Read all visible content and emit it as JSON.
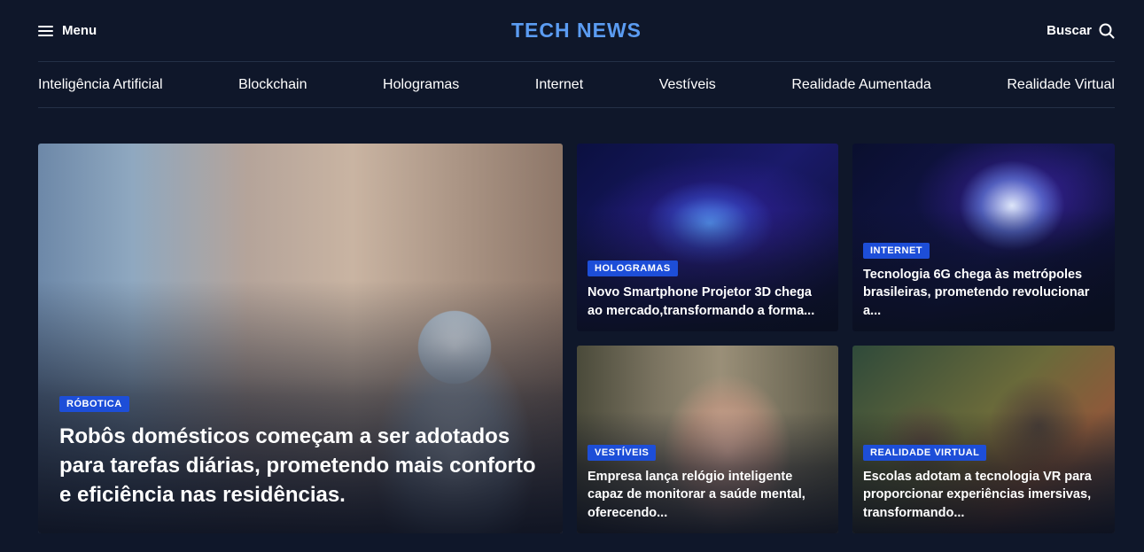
{
  "header": {
    "menu_label": "Menu",
    "logo": "TECH NEWS",
    "search_label": "Buscar"
  },
  "nav": {
    "items": [
      {
        "label": "Inteligência Artificial"
      },
      {
        "label": "Blockchain"
      },
      {
        "label": "Hologramas"
      },
      {
        "label": "Internet"
      },
      {
        "label": "Vestíveis"
      },
      {
        "label": "Realidade Aumentada"
      },
      {
        "label": "Realidade Virtual"
      }
    ]
  },
  "colors": {
    "background": "#0f172a",
    "logo": "#5b9cf2",
    "badge": "#1d4ed8"
  },
  "featured": {
    "category": "RÓBOTICA",
    "title": "Robôs domésticos começam a ser adotados para tarefas diárias, prometendo mais conforto e eficiência nas residências.",
    "image": "robot-in-bedroom"
  },
  "articles": [
    {
      "category": "HOLOGRAMAS",
      "title": "Novo Smartphone Projetor 3D chega ao mercado,transformando a forma...",
      "image": "hand-holding-holographic-phone"
    },
    {
      "category": "INTERNET",
      "title": "Tecnologia 6G chega às metrópoles brasileiras, prometendo revolucionar a...",
      "image": "6g-rocket"
    },
    {
      "category": "VESTÍVEIS",
      "title": "Empresa lança relógio inteligente capaz de monitorar a saúde mental, oferecendo...",
      "image": "woman-with-smartwatch"
    },
    {
      "category": "REALIDADE VIRTUAL",
      "title": "Escolas adotam a tecnologia VR para proporcionar experiências imersivas, transformando...",
      "image": "kids-with-vr-headsets"
    }
  ]
}
